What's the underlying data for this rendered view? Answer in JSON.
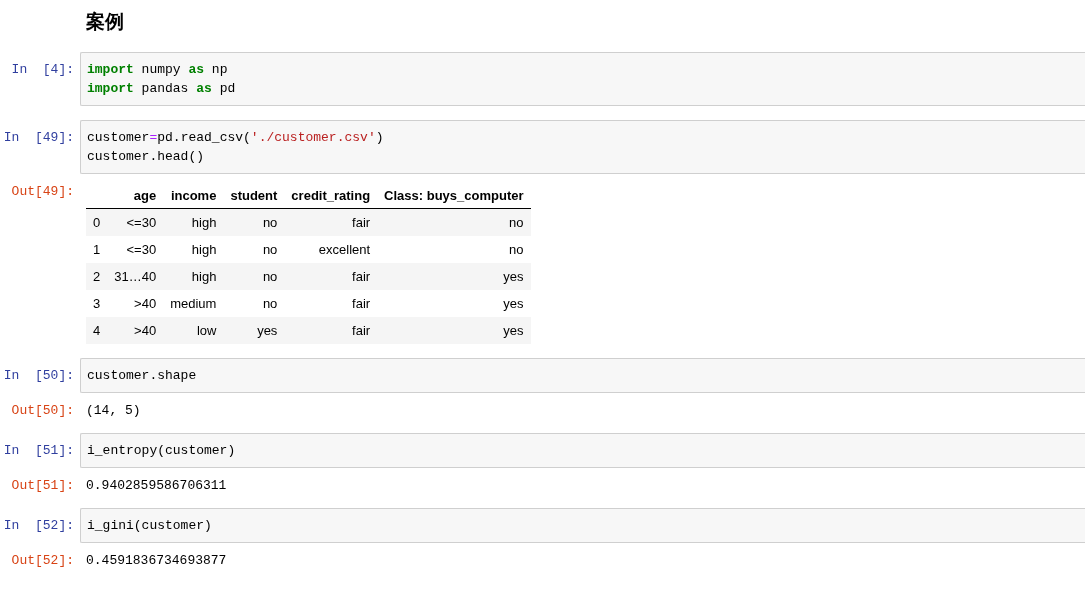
{
  "heading": "案例",
  "cells": [
    {
      "prompt": "In  [4]:",
      "lines": [
        [
          {
            "text": "import",
            "kind": "keyword"
          },
          {
            "text": " numpy ",
            "kind": "plain"
          },
          {
            "text": "as",
            "kind": "keyword"
          },
          {
            "text": " np",
            "kind": "plain"
          }
        ],
        [
          {
            "text": "import",
            "kind": "keyword"
          },
          {
            "text": " pandas ",
            "kind": "plain"
          },
          {
            "text": "as",
            "kind": "keyword"
          },
          {
            "text": " pd",
            "kind": "plain"
          }
        ]
      ]
    },
    {
      "prompt": "In  [49]:",
      "lines": [
        [
          {
            "text": "customer",
            "kind": "plain"
          },
          {
            "text": "=",
            "kind": "operator"
          },
          {
            "text": "pd.read_csv(",
            "kind": "plain"
          },
          {
            "text": "'./customer.csv'",
            "kind": "string"
          },
          {
            "text": ")",
            "kind": "plain"
          }
        ],
        [
          {
            "text": "customer.head()",
            "kind": "plain"
          }
        ]
      ],
      "output": {
        "prompt": "Out[49]:",
        "kind": "table",
        "columns": [
          "",
          "age",
          "income",
          "student",
          "credit_rating",
          "Class: buys_computer"
        ],
        "rows": [
          [
            "0",
            "<=30",
            "high",
            "no",
            "fair",
            "no"
          ],
          [
            "1",
            "<=30",
            "high",
            "no",
            "excellent",
            "no"
          ],
          [
            "2",
            "31…40",
            "high",
            "no",
            "fair",
            "yes"
          ],
          [
            "3",
            ">40",
            "medium",
            "no",
            "fair",
            "yes"
          ],
          [
            "4",
            ">40",
            "low",
            "yes",
            "fair",
            "yes"
          ]
        ]
      }
    },
    {
      "prompt": "In  [50]:",
      "lines": [
        [
          {
            "text": "customer.shape",
            "kind": "plain"
          }
        ]
      ],
      "output": {
        "prompt": "Out[50]:",
        "kind": "text",
        "text": "(14, 5)"
      }
    },
    {
      "prompt": "In  [51]:",
      "lines": [
        [
          {
            "text": "i_entropy(customer)",
            "kind": "plain"
          }
        ]
      ],
      "output": {
        "prompt": "Out[51]:",
        "kind": "text",
        "text": "0.9402859586706311"
      }
    },
    {
      "prompt": "In  [52]:",
      "lines": [
        [
          {
            "text": "i_gini(customer)",
            "kind": "plain"
          }
        ]
      ],
      "output": {
        "prompt": "Out[52]:",
        "kind": "text",
        "text": "0.4591836734693877"
      }
    }
  ]
}
